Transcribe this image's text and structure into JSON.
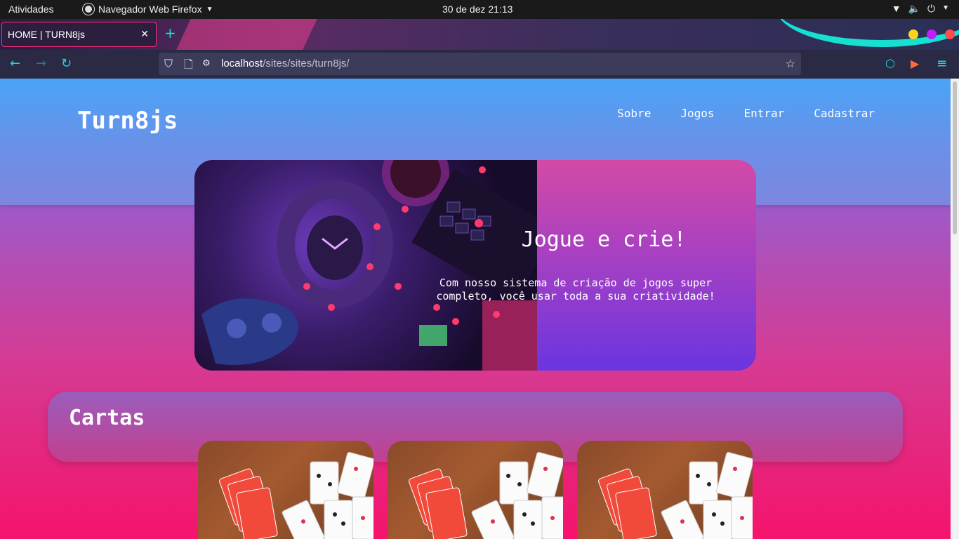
{
  "system_bar": {
    "activities": "Atividades",
    "app_name": "Navegador Web Firefox",
    "clock": "30 de dez  21:13",
    "tray_icons": [
      "wifi-icon",
      "volume-icon",
      "power-icon"
    ]
  },
  "browser": {
    "tab_title": "HOME | TURN8js",
    "url_host": "localhost",
    "url_path": "/sites/sites/turn8js/",
    "accent_color": "#18d6e0"
  },
  "site": {
    "logo": "Turn8js",
    "nav": [
      "Sobre",
      "Jogos",
      "Entrar",
      "Cadastrar"
    ],
    "hero": {
      "title": "Jogue e crie!",
      "text": "Com nosso sistema de criação de jogos super completo, você usar toda a sua criatividade!"
    },
    "cards_section": {
      "title": "Cartas",
      "card_count": 3
    }
  }
}
